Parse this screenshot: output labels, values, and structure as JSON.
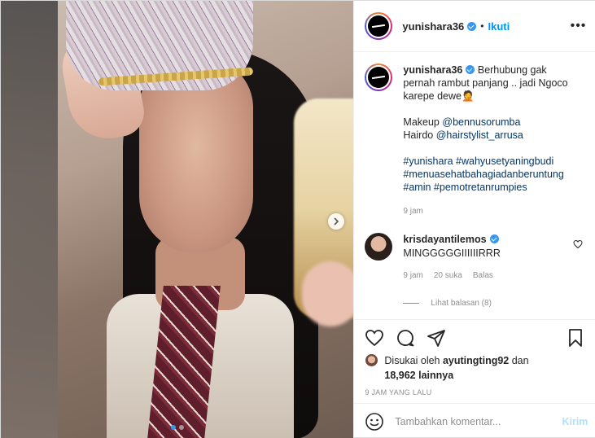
{
  "header": {
    "username": "yunishara36",
    "follow_label": "Ikuti",
    "separator": "•",
    "more_icon": "•••"
  },
  "caption": {
    "username": "yunishara36",
    "text_line1": "Berhubung gak pernah rambut panjang .. jadi Ngoco karepe dewe🤦",
    "makeup_label": "Makeup",
    "makeup_tag": "@bennusorumba",
    "hairdo_label": "Hairdo",
    "hairdo_tag": "@hairstylist_arrusa",
    "hashtags": "#yunishara #wahyusetyaningbudi #menuasehatbahagiadanberuntung #amin #pemotretanrumpies",
    "time": "9 jam"
  },
  "comment": {
    "username": "krisdayantilemos",
    "text": "MINGGGGGIIIIIIRRR",
    "time": "9 jam",
    "likes": "20 suka",
    "reply_label": "Balas",
    "view_replies": "Lihat balasan (8)"
  },
  "likes": {
    "prefix": "Disukai oleh",
    "user": "ayutingting92",
    "middle": "dan",
    "count": "18,962 lainnya"
  },
  "post_time": "9 JAM YANG LALU",
  "add_comment": {
    "placeholder": "Tambahkan komentar...",
    "post_label": "Kirim"
  },
  "carousel": {
    "slide_count": 2,
    "active_index": 0
  },
  "colors": {
    "accent": "#0095f6",
    "verified": "#3897f0",
    "hashtag": "#00376b"
  }
}
